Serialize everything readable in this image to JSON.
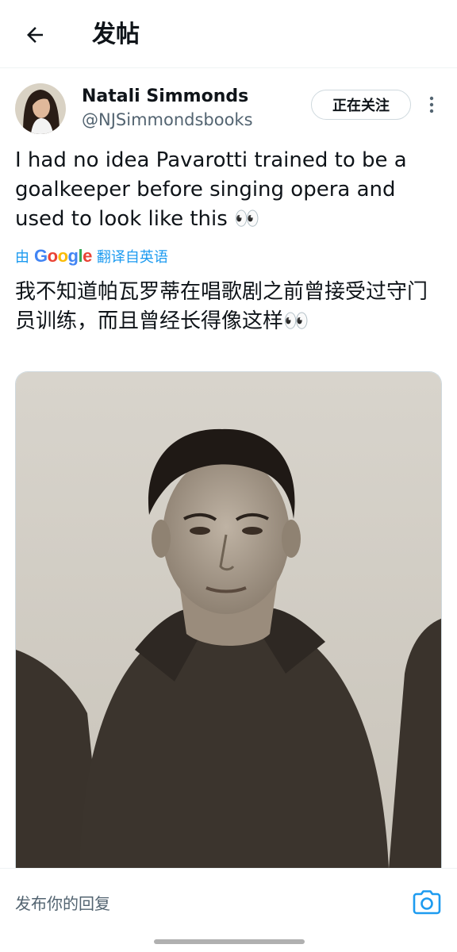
{
  "header": {
    "title": "发帖",
    "back_icon": "arrow-left-icon"
  },
  "post": {
    "author_name": "Natali Simmonds",
    "author_handle": "@NJSimmondsbooks",
    "follow_label": "正在关注",
    "more_icon": "more-vertical-icon",
    "text": "I had no idea Pavarotti trained to be a goalkeeper before singing opera and used to look like this 👀",
    "translation": {
      "prefix": "由",
      "provider": "Google",
      "suffix": "翻译自英语",
      "text": "我不知道帕瓦罗蒂在唱歌剧之前曾接受过守门员训练，而且曾经长得像这样👀"
    }
  },
  "reply": {
    "placeholder": "发布你的回复",
    "camera_icon": "camera-icon"
  },
  "colors": {
    "accent": "#1d9bf0",
    "text": "#0f1419",
    "secondary": "#536471",
    "google_blue": "#4285f4",
    "google_red": "#ea4335",
    "google_yellow": "#fbbc05",
    "google_green": "#34a853"
  }
}
